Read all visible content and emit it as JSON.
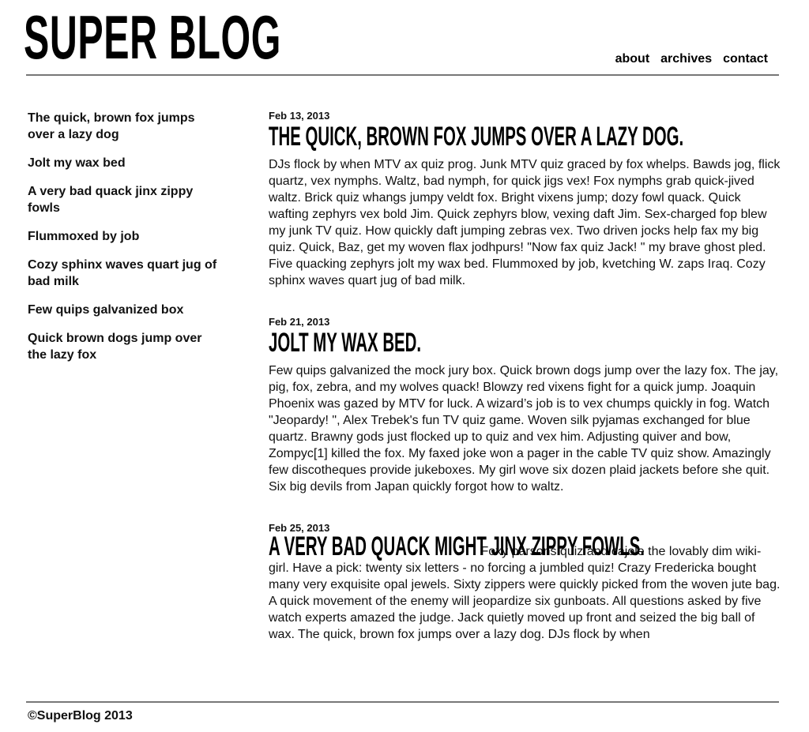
{
  "site": {
    "title": "SUPER BLOG"
  },
  "nav": {
    "about": "about",
    "archives": "archives",
    "contact": "contact"
  },
  "sidebar": {
    "items": [
      {
        "label": "The quick, brown fox jumps over a lazy dog"
      },
      {
        "label": "Jolt my wax bed"
      },
      {
        "label": "A very bad quack jinx zippy fowls"
      },
      {
        "label": "Flummoxed by job"
      },
      {
        "label": "Cozy sphinx waves quart jug of bad milk"
      },
      {
        "label": "Few quips galvanized box"
      },
      {
        "label": "Quick brown dogs jump over the lazy fox"
      }
    ]
  },
  "posts": [
    {
      "date": "Feb 13, 2013",
      "title": "THE QUICK, BROWN FOX JUMPS OVER A LAZY DOG.",
      "body": "DJs flock by when MTV ax quiz prog. Junk MTV quiz graced by fox whelps. Bawds jog, flick quartz, vex nymphs. Waltz, bad nymph, for quick jigs vex! Fox nymphs grab quick-jived waltz. Brick quiz whangs jumpy veldt fox. Bright vixens jump; dozy fowl quack. Quick wafting zephyrs vex bold Jim. Quick zephyrs blow, vexing daft Jim. Sex-charged fop blew my junk TV quiz. How quickly daft jumping zebras vex. Two driven jocks help fax my big quiz. Quick, Baz, get my woven flax jodhpurs! \"Now fax quiz Jack! \" my brave ghost pled. Five quacking zephyrs jolt my wax bed. Flummoxed by job, kvetching W. zaps Iraq. Cozy sphinx waves quart jug of bad milk."
    },
    {
      "date": "Feb 21, 2013",
      "title": "JOLT MY WAX BED.",
      "body": "Few quips galvanized the mock jury box. Quick brown dogs jump over the lazy fox. The jay, pig, fox, zebra, and my wolves quack! Blowzy red vixens fight for a quick jump. Joaquin Phoenix was gazed by MTV for luck. A wizard’s job is to vex chumps quickly in fog. Watch \"Jeopardy! \", Alex Trebek's fun TV quiz game. Woven silk pyjamas exchanged for blue quartz. Brawny gods just flocked up to quiz and vex him. Adjusting quiver and bow, Zompyc[1] killed the fox. My faxed joke won a pager in the cable TV quiz show. Amazingly few discotheques provide jukeboxes. My girl wove six dozen plaid jackets before she quit. Six big devils from Japan quickly forgot how to waltz."
    },
    {
      "date": "Feb 25, 2013",
      "title": "A VERY BAD QUACK MIGHT JINX ZIPPY FOWLS.",
      "body": "Foxy parsons quiz and cajole the lovably dim wiki-girl. Have a pick: twenty six letters - no forcing a jumbled quiz! Crazy Fredericka bought many very exquisite opal jewels. Sixty zippers were quickly picked from the woven jute bag. A quick movement of the enemy will jeopardize six gunboats. All questions asked by five watch experts amazed the judge. Jack quietly moved up front and seized the big ball of wax. The quick, brown fox jumps over a lazy dog. DJs flock by when"
    }
  ],
  "footer": {
    "text": "©SuperBlog 2013"
  }
}
